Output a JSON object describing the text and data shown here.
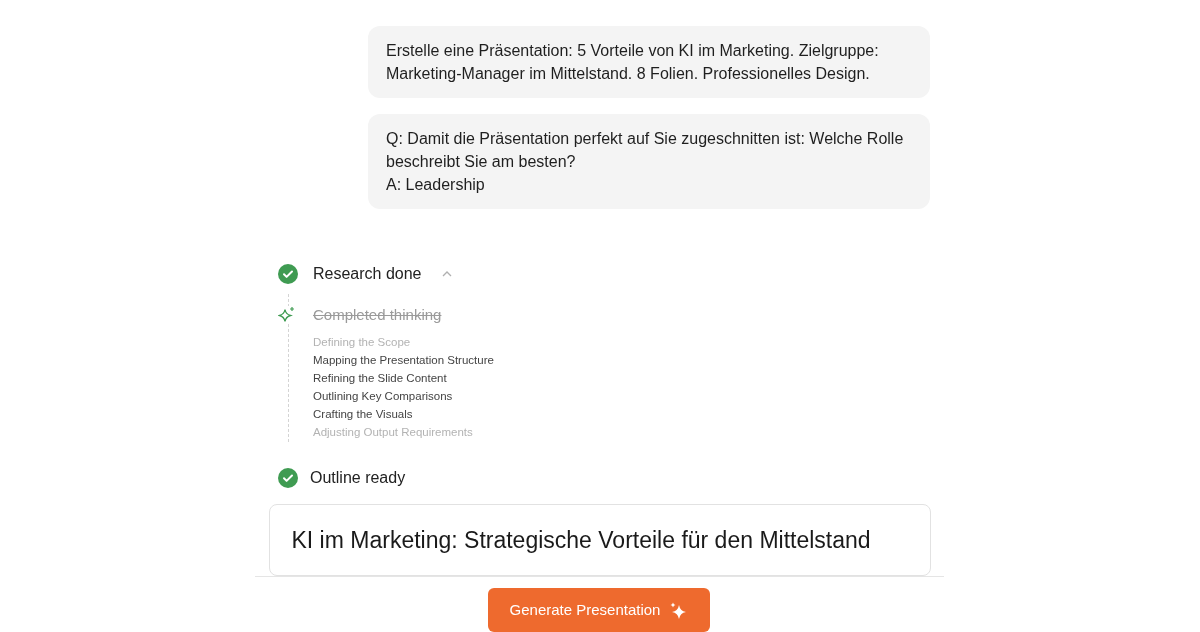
{
  "messages": [
    {
      "lines": [
        "Erstelle eine Präsentation: 5 Vorteile von KI im Marketing. Zielgruppe: Marketing-Manager im Mittelstand. 8 Folien. Professionelles Design."
      ]
    },
    {
      "lines": [
        "Q: Damit die Präsentation perfekt auf Sie zugeschnitten ist: Welche Rolle beschreibt Sie am besten?",
        "A: Leadership"
      ]
    }
  ],
  "research": {
    "label": "Research done",
    "done": true,
    "expanded": true,
    "thinking": {
      "label": "Completed thinking",
      "completed": true
    },
    "steps": [
      {
        "label": "Defining the Scope",
        "faded": true
      },
      {
        "label": "Mapping the Presentation Structure",
        "faded": false
      },
      {
        "label": "Refining the Slide Content",
        "faded": false
      },
      {
        "label": "Outlining Key Comparisons",
        "faded": false
      },
      {
        "label": "Crafting the Visuals",
        "faded": false
      },
      {
        "label": "Adjusting Output Requirements",
        "faded": true
      }
    ]
  },
  "outline": {
    "label": "Outline ready",
    "done": true,
    "title": "KI im Marketing: Strategische Vorteile für den Mittelstand"
  },
  "generate_button": "Generate Presentation"
}
